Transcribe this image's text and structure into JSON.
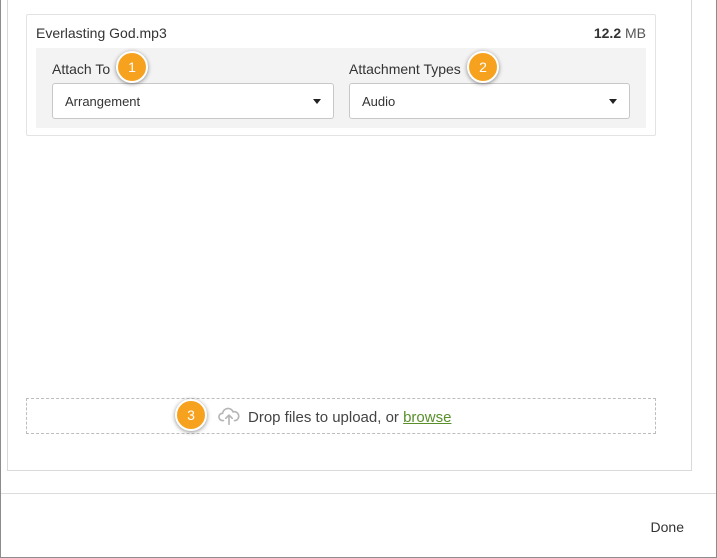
{
  "file": {
    "name": "Everlasting God.mp3",
    "size_value": "12.2",
    "size_unit": "MB"
  },
  "attach_to": {
    "label": "Attach To",
    "selected": "Arrangement"
  },
  "attachment_types": {
    "label": "Attachment Types",
    "selected": "Audio"
  },
  "callouts": [
    "1",
    "2",
    "3"
  ],
  "dropzone": {
    "text": "Drop files to upload, or ",
    "link": "browse",
    "icon": "cloud-upload-icon"
  },
  "footer": {
    "done_label": "Done"
  },
  "colors": {
    "callout": "#f6a21e",
    "link": "#5a8f2b"
  }
}
